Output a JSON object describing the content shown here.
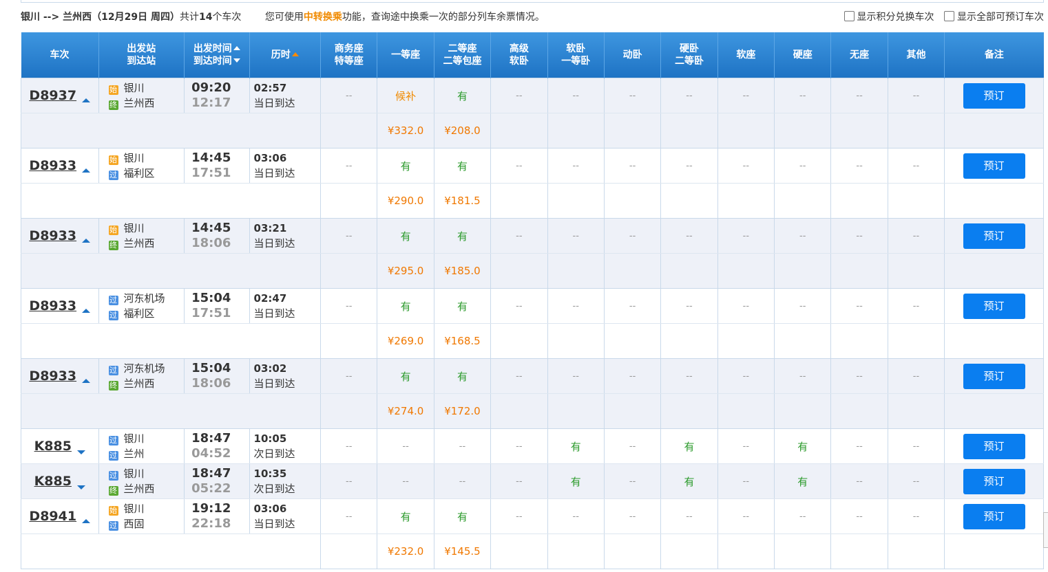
{
  "summary": {
    "route": "银川 --> 兰州西（12月29日  周四）",
    "count_prefix": "共计",
    "count": "14",
    "count_suffix": "个车次",
    "hint_prefix": "您可使用",
    "hint_link": "中转换乘",
    "hint_suffix": "功能，查询途中换乘一次的部分列车余票情况。"
  },
  "options": {
    "points": "显示积分兑换车次",
    "all": "显示全部可预订车次"
  },
  "headers": {
    "train": "车次",
    "stations_1": "出发站",
    "stations_2": "到达站",
    "time_1": "出发时间",
    "time_2": "到达时间",
    "duration": "历时",
    "business_1": "商务座",
    "business_2": "特等座",
    "first": "一等座",
    "second_1": "二等座",
    "second_2": "二等包座",
    "senior_1": "高级",
    "senior_2": "软卧",
    "soft_sleeper_1": "软卧",
    "soft_sleeper_2": "一等卧",
    "dong_sleeper": "动卧",
    "hard_sleeper_1": "硬卧",
    "hard_sleeper_2": "二等卧",
    "soft_seat": "软座",
    "hard_seat": "硬座",
    "no_seat": "无座",
    "other": "其他",
    "remarks": "备注"
  },
  "badges": {
    "start": "始",
    "pass": "过",
    "end": "终"
  },
  "book_label": "预订",
  "rows": [
    {
      "train": "D8937",
      "dir": "up",
      "from": "银川",
      "from_badge": "start",
      "to": "兰州西",
      "to_badge": "end",
      "dep": "09:20",
      "arr": "12:17",
      "dur": "02:57",
      "arrive_day": "当日到达",
      "seats": [
        "--",
        "候补",
        "有",
        "--",
        "--",
        "--",
        "--",
        "--",
        "--",
        "--",
        "--"
      ],
      "prices": [
        "",
        "¥332.0",
        "¥208.0",
        "",
        "",
        "",
        "",
        "",
        "",
        "",
        ""
      ],
      "shade": true
    },
    {
      "train": "D8933",
      "dir": "up",
      "from": "银川",
      "from_badge": "start",
      "to": "福利区",
      "to_badge": "pass",
      "dep": "14:45",
      "arr": "17:51",
      "dur": "03:06",
      "arrive_day": "当日到达",
      "seats": [
        "--",
        "有",
        "有",
        "--",
        "--",
        "--",
        "--",
        "--",
        "--",
        "--",
        "--"
      ],
      "prices": [
        "",
        "¥290.0",
        "¥181.5",
        "",
        "",
        "",
        "",
        "",
        "",
        "",
        ""
      ],
      "shade": false
    },
    {
      "train": "D8933",
      "dir": "up",
      "from": "银川",
      "from_badge": "start",
      "to": "兰州西",
      "to_badge": "end",
      "dep": "14:45",
      "arr": "18:06",
      "dur": "03:21",
      "arrive_day": "当日到达",
      "seats": [
        "--",
        "有",
        "有",
        "--",
        "--",
        "--",
        "--",
        "--",
        "--",
        "--",
        "--"
      ],
      "prices": [
        "",
        "¥295.0",
        "¥185.0",
        "",
        "",
        "",
        "",
        "",
        "",
        "",
        ""
      ],
      "shade": true
    },
    {
      "train": "D8933",
      "dir": "up",
      "from": "河东机场",
      "from_badge": "pass",
      "to": "福利区",
      "to_badge": "pass",
      "dep": "15:04",
      "arr": "17:51",
      "dur": "02:47",
      "arrive_day": "当日到达",
      "seats": [
        "--",
        "有",
        "有",
        "--",
        "--",
        "--",
        "--",
        "--",
        "--",
        "--",
        "--"
      ],
      "prices": [
        "",
        "¥269.0",
        "¥168.5",
        "",
        "",
        "",
        "",
        "",
        "",
        "",
        ""
      ],
      "shade": false
    },
    {
      "train": "D8933",
      "dir": "up",
      "from": "河东机场",
      "from_badge": "pass",
      "to": "兰州西",
      "to_badge": "end",
      "dep": "15:04",
      "arr": "18:06",
      "dur": "03:02",
      "arrive_day": "当日到达",
      "seats": [
        "--",
        "有",
        "有",
        "--",
        "--",
        "--",
        "--",
        "--",
        "--",
        "--",
        "--"
      ],
      "prices": [
        "",
        "¥274.0",
        "¥172.0",
        "",
        "",
        "",
        "",
        "",
        "",
        "",
        ""
      ],
      "shade": true
    },
    {
      "train": "K885",
      "dir": "down",
      "from": "银川",
      "from_badge": "pass",
      "to": "兰州",
      "to_badge": "pass",
      "dep": "18:47",
      "arr": "04:52",
      "dur": "10:05",
      "arrive_day": "次日到达",
      "seats": [
        "--",
        "--",
        "--",
        "--",
        "有",
        "--",
        "有",
        "--",
        "有",
        "--",
        "--"
      ],
      "prices": null,
      "shade": false
    },
    {
      "train": "K885",
      "dir": "down",
      "from": "银川",
      "from_badge": "pass",
      "to": "兰州西",
      "to_badge": "end",
      "dep": "18:47",
      "arr": "05:22",
      "dur": "10:35",
      "arrive_day": "次日到达",
      "seats": [
        "--",
        "--",
        "--",
        "--",
        "有",
        "--",
        "有",
        "--",
        "有",
        "--",
        "--"
      ],
      "prices": null,
      "shade": true
    },
    {
      "train": "D8941",
      "dir": "up",
      "from": "银川",
      "from_badge": "start",
      "to": "西固",
      "to_badge": "pass",
      "dep": "19:12",
      "arr": "22:18",
      "dur": "03:06",
      "arrive_day": "当日到达",
      "seats": [
        "--",
        "有",
        "有",
        "--",
        "--",
        "--",
        "--",
        "--",
        "--",
        "--",
        "--"
      ],
      "prices": [
        "",
        "¥232.0",
        "¥145.5",
        "",
        "",
        "",
        "",
        "",
        "",
        "",
        ""
      ],
      "shade": false
    }
  ],
  "colors": {
    "header_top": "#3e96e0",
    "header_bottom": "#1e73c4",
    "book_button": "#0a7ef0",
    "available": "#2b9a2b",
    "price": "#f07800",
    "row_shade": "#eef1f8"
  }
}
